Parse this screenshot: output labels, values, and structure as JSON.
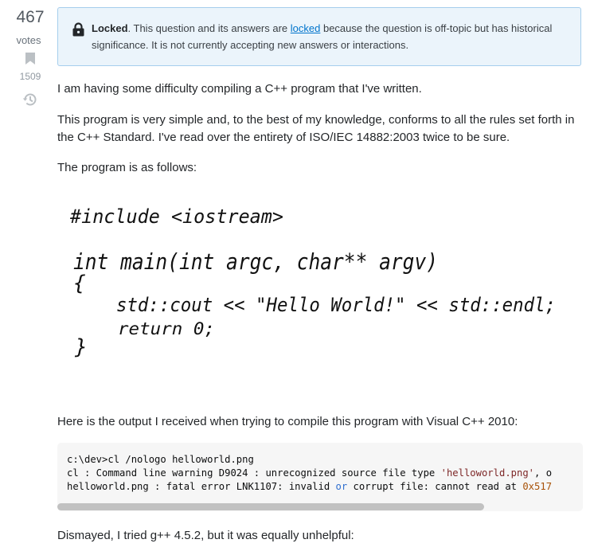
{
  "votes": {
    "count": "467",
    "label": "votes",
    "bookmarks": "1509"
  },
  "notice": {
    "title": "Locked",
    "text_before": ". This question and its answers are ",
    "link": "locked",
    "text_after": " because the question is off-topic but has historical significance. It is not currently accepting new answers or interactions."
  },
  "post": {
    "p1": "I am having some difficulty compiling a C++ program that I've written.",
    "p2": "This program is very simple and, to the best of my knowledge, conforms to all the rules set forth in the C++ Standard. I've read over the entirety of ISO/IEC 14882:2003 twice to be sure.",
    "p3": "The program is as follows:",
    "handwriting": {
      "line1": "#include <iostream>",
      "line2": "int main(int argc, char** argv)",
      "line3": "{",
      "line4": "std::cout << \"Hello World!\" << std::endl;",
      "line5": "return 0;",
      "line6": "}"
    },
    "p4": "Here is the output I received when trying to compile this program with Visual C++ 2010:",
    "code": {
      "line1": "c:\\dev>cl /nologo helloworld.png",
      "line2_a": "cl : Command line warning D9024 : unrecognized source file type ",
      "line2_str": "'helloworld.png'",
      "line2_b": ", o",
      "line3_a": "helloworld.png : fatal error LNK1107: invalid ",
      "line3_kw": "or",
      "line3_b": " corrupt file: cannot read at ",
      "line3_num": "0x517"
    },
    "p5": "Dismayed, I tried g++ 4.5.2, but it was equally unhelpful:"
  },
  "colors": {
    "link": "#0074cc",
    "notice_bg": "#ebf4fb",
    "notice_border": "#a6ceed",
    "code_bg": "#f6f6f6"
  }
}
